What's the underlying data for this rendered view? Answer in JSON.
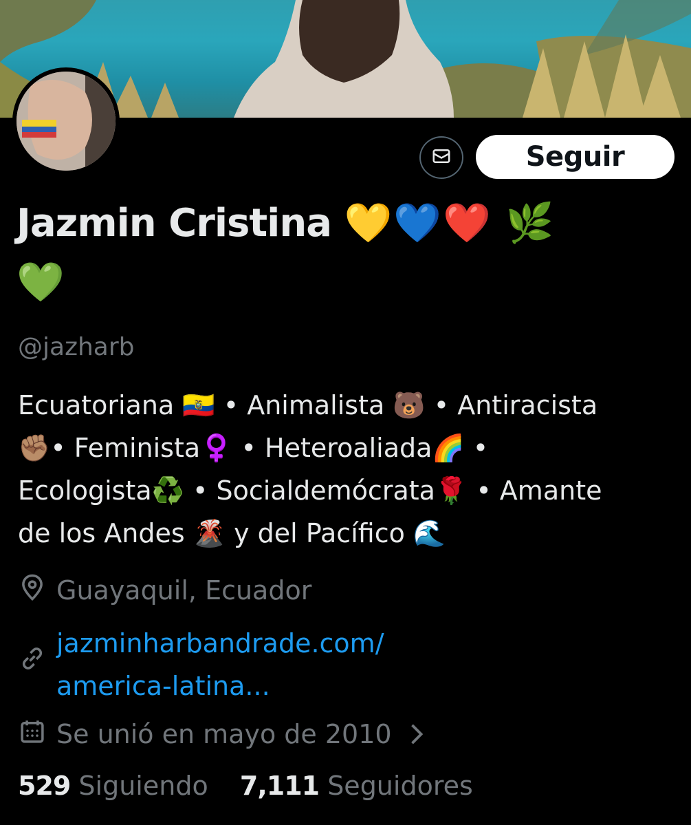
{
  "profile": {
    "display_name": "Jazmin Cristina",
    "name_emojis_line1": "💛💙❤️ 🌿",
    "name_emojis_line2": "💚",
    "handle": "@jazharb",
    "follow_label": "Seguir",
    "bio_lines": [
      "Ecuatoriana 🇪🇨 • Animalista 🐻 • Antiracista",
      "✊🏽•  Feminista♀️ • Heteroaliada🌈 •",
      "Ecologista♻️ • Socialdemócrata🌹 • Amante",
      "de los Andes 🌋 y del Pacífico 🌊"
    ],
    "location": "Guayaquil, Ecuador",
    "website_line1": "jazminharbandrade.com/",
    "website_line2": "america-latina...",
    "joined": "Se unió en mayo de 2010",
    "following_count": "529",
    "following_label": "Siguiendo",
    "followers_count": "7,111",
    "followers_label": "Seguidores"
  },
  "icons": {
    "message": "envelope-icon",
    "location": "map-pin-icon",
    "link": "link-icon",
    "calendar": "calendar-icon",
    "chevron": "chevron-right-icon"
  },
  "colors": {
    "background": "#000000",
    "text_primary": "#e7e9ea",
    "text_secondary": "#71767b",
    "link": "#1d9bf0",
    "follow_button_bg": "#ffffff"
  }
}
